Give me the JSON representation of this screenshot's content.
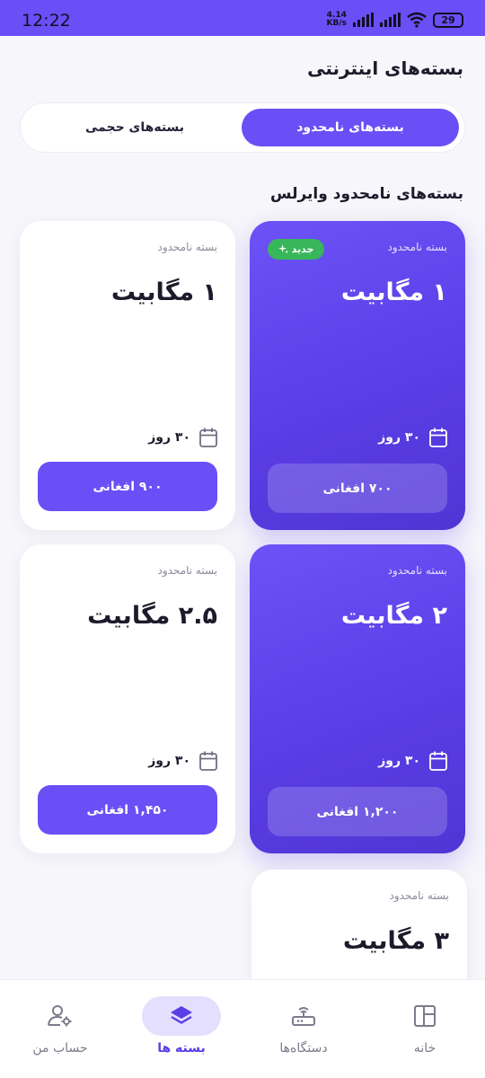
{
  "status_bar": {
    "time": "12:22",
    "net_speed_value": "4.14",
    "net_speed_unit": "KB/s",
    "battery": "29"
  },
  "page": {
    "title": "بسته‌های اینترنتی"
  },
  "tabs": {
    "active_label": "بسته‌های نامحدود",
    "inactive_label": "بسته‌های حجمی"
  },
  "section": {
    "title": "بسته‌های نامحدود وایرلس"
  },
  "cards": [
    {
      "label": "بسته نامحدود",
      "badge": "جدید",
      "title": "۱ مگابیت",
      "duration": "۳۰ روز",
      "price": "۷۰۰ افغانی"
    },
    {
      "label": "بسته نامحدود",
      "title": "۱ مگابیت",
      "duration": "۳۰ روز",
      "price": "۹۰۰ افغانی"
    },
    {
      "label": "بسته نامحدود",
      "title": "۲ مگابیت",
      "duration": "۳۰ روز",
      "price": "۱,۲۰۰ افغانی"
    },
    {
      "label": "بسته نامحدود",
      "title": "۲.۵ مگابیت",
      "duration": "۳۰ روز",
      "price": "۱,۴۵۰ افغانی"
    },
    {
      "label": "بسته نامحدود",
      "title": "۳ مگابیت"
    }
  ],
  "bottom_nav": {
    "home": "خانه",
    "devices": "دستگاه‌ها",
    "packages": "بسته ها",
    "account": "حساب من"
  },
  "colors": {
    "accent": "#6a4ff6",
    "badge_green": "#38b65a",
    "nav_active_bg": "#e4dffd"
  },
  "icons": {
    "home": "layout-grid-icon",
    "devices": "router-icon",
    "packages": "layers-icon",
    "account": "user-settings-icon",
    "duration": "calendar-icon",
    "badge": "sparkle-icon"
  }
}
